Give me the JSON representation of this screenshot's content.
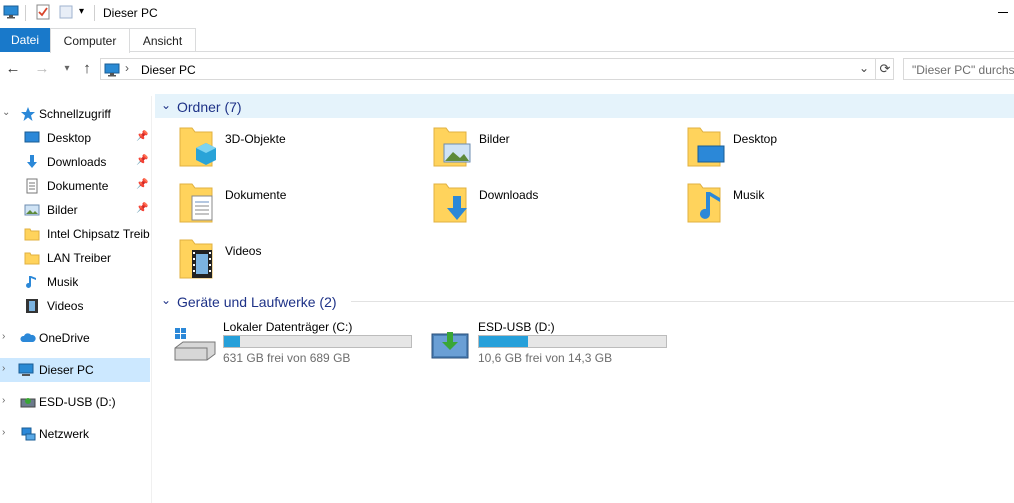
{
  "window": {
    "title": "Dieser PC"
  },
  "ribbon": {
    "tabs": [
      "Datei",
      "Computer",
      "Ansicht"
    ]
  },
  "address": {
    "path": "Dieser PC",
    "search_placeholder": "\"Dieser PC\" durchsuchen"
  },
  "sidebar": {
    "quick_access": "Schnellzugriff",
    "items": [
      {
        "label": "Desktop",
        "icon": "desktop-icon",
        "pinned": true
      },
      {
        "label": "Downloads",
        "icon": "downloads-icon",
        "pinned": true
      },
      {
        "label": "Dokumente",
        "icon": "documents-icon",
        "pinned": true
      },
      {
        "label": "Bilder",
        "icon": "pictures-icon",
        "pinned": true
      },
      {
        "label": "Intel Chipsatz Treiber",
        "icon": "folder-icon",
        "pinned": false
      },
      {
        "label": "LAN Treiber",
        "icon": "folder-icon",
        "pinned": false
      },
      {
        "label": "Musik",
        "icon": "music-icon",
        "pinned": false
      },
      {
        "label": "Videos",
        "icon": "videos-icon",
        "pinned": false
      }
    ],
    "onedrive": "OneDrive",
    "this_pc": "Dieser PC",
    "usb": "ESD-USB (D:)",
    "network": "Netzwerk"
  },
  "content": {
    "folders_header": "Ordner (7)",
    "folders": [
      {
        "name": "3D-Objekte",
        "icon": "3d-objects-folder-icon"
      },
      {
        "name": "Bilder",
        "icon": "pictures-folder-icon"
      },
      {
        "name": "Desktop",
        "icon": "desktop-folder-icon"
      },
      {
        "name": "Dokumente",
        "icon": "documents-folder-icon"
      },
      {
        "name": "Downloads",
        "icon": "downloads-folder-icon"
      },
      {
        "name": "Musik",
        "icon": "music-folder-icon"
      },
      {
        "name": "Videos",
        "icon": "videos-folder-icon"
      }
    ],
    "drives_header": "Geräte und Laufwerke (2)",
    "drives": [
      {
        "name": "Lokaler Datenträger (C:)",
        "free_text": "631 GB frei von 689 GB",
        "used_fraction": 0.084
      },
      {
        "name": "ESD-USB (D:)",
        "free_text": "10,6 GB frei von 14,3 GB",
        "used_fraction": 0.26
      }
    ]
  },
  "colors": {
    "accent": "#1979ca",
    "selection": "#cce8ff",
    "group_header": "#1e3287",
    "bar_fill": "#26a0da",
    "folder": "#ffd35c"
  }
}
